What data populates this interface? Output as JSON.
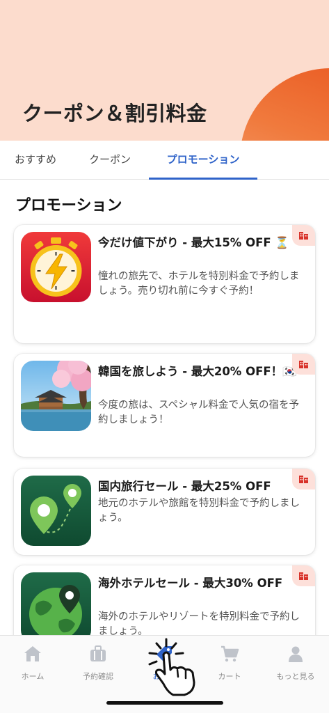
{
  "header": {
    "title": "クーポン＆割引料金"
  },
  "tabs": [
    {
      "label": "おすすめ"
    },
    {
      "label": "クーポン"
    },
    {
      "label": "プロモーション",
      "active": true
    }
  ],
  "section": {
    "title": "プロモーション"
  },
  "promotions": [
    {
      "title": "今だけ値下がり - 最大15% OFF ⏳",
      "description": "憧れの旅先で、ホテルを特別料金で予約しましょう。売り切れ前に今すぐ予約！",
      "icon": "stopwatch-lightning-icon"
    },
    {
      "title": "韓国を旅しよう - 最大20% OFF！🇰🇷",
      "description": "今度の旅は、スペシャル料金で人気の宿を予約しましょう！",
      "icon": "korea-palace-photo"
    },
    {
      "title": "国内旅行セール - 最大25% OFF",
      "description": "地元のホテルや旅館を特別料金で予約しましょう。",
      "icon": "map-pins-icon"
    },
    {
      "title": "海外ホテルセール - 最大30% OFF",
      "description": "海外のホテルやリゾートを特別料金で予約しましょう。",
      "icon": "globe-pin-icon"
    }
  ],
  "bottom_nav": [
    {
      "label": "ホーム",
      "icon": "home-icon"
    },
    {
      "label": "予約確認",
      "icon": "briefcase-icon"
    },
    {
      "label": "おトク",
      "icon": "tag-icon"
    },
    {
      "label": "カート",
      "icon": "cart-icon"
    },
    {
      "label": "もっと見る",
      "icon": "person-icon"
    }
  ],
  "colors": {
    "accent": "#2f63c9",
    "header_bg": "#fcdccd",
    "badge_bg": "#fde0da"
  }
}
